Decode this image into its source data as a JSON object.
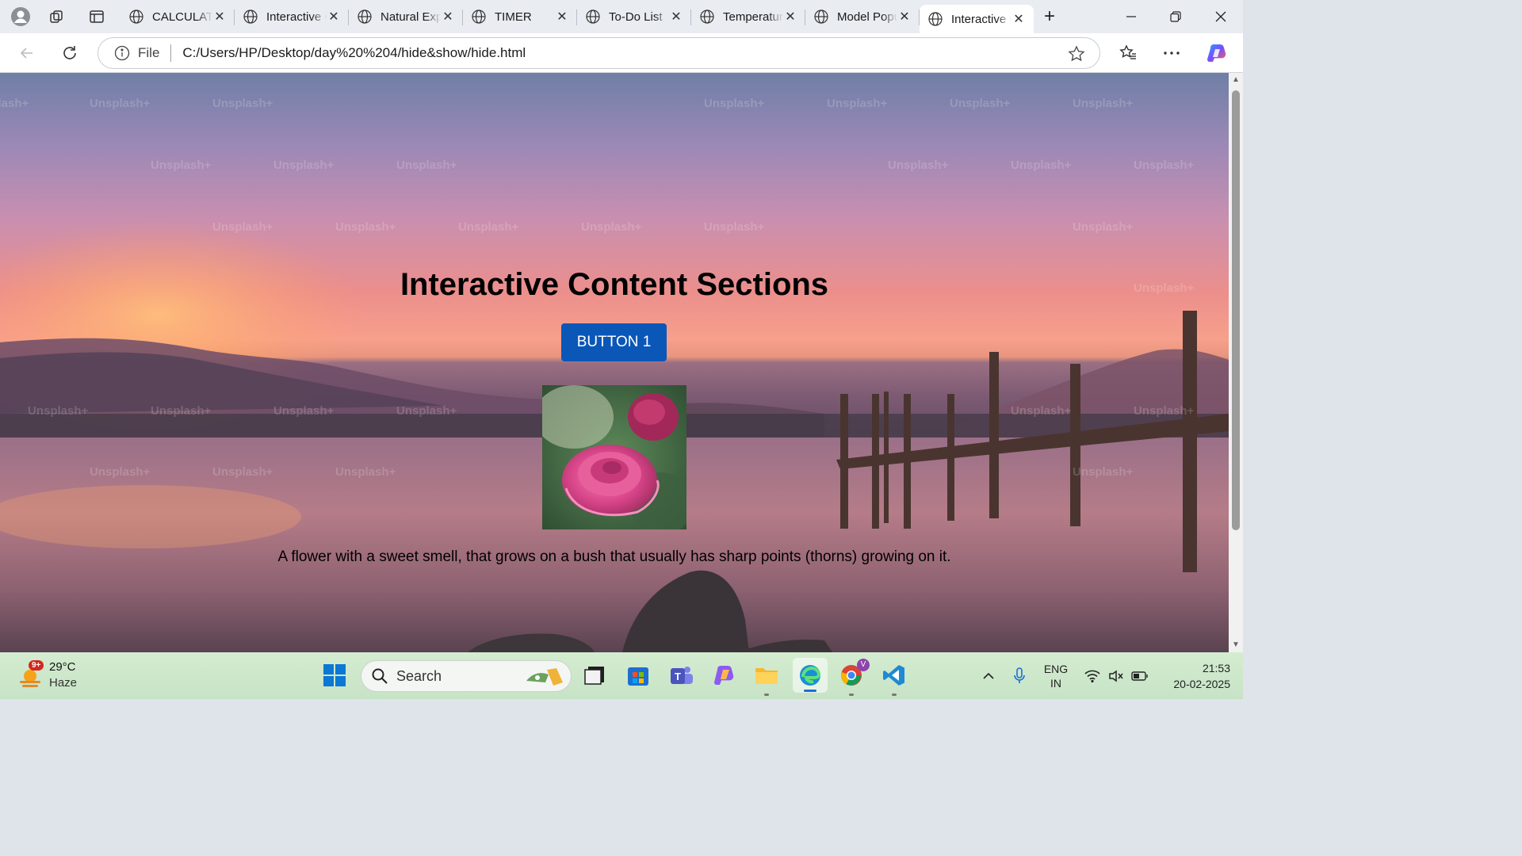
{
  "browser": {
    "tabs": [
      {
        "label": "CALCULATOR",
        "active": false
      },
      {
        "label": "Interactive Content Sections",
        "active": false
      },
      {
        "label": "Natural Explorer",
        "active": false
      },
      {
        "label": "TIMER",
        "active": false
      },
      {
        "label": "To-Do List",
        "active": false
      },
      {
        "label": "Temperature",
        "active": false
      },
      {
        "label": "Model Popup",
        "active": false
      },
      {
        "label": "Interactive Content Sections",
        "active": true
      }
    ],
    "address": {
      "scheme_label": "File",
      "url": "C:/Users/HP/Desktop/day%20%204/hide&show/hide.html"
    }
  },
  "page": {
    "heading": "Interactive Content Sections",
    "button_label": "BUTTON 1",
    "description": "A flower with a sweet smell, that grows on a bush that usually has sharp points (thorns) growing on it.",
    "watermark": "Unsplash+"
  },
  "taskbar": {
    "weather": {
      "temp": "29°C",
      "condition": "Haze",
      "badge": "9+"
    },
    "search_label": "Search",
    "tray": {
      "lang_top": "ENG",
      "lang_bottom": "IN",
      "time": "21:53",
      "date": "20-02-2025"
    }
  },
  "colors": {
    "button_bg": "#0a57b8",
    "taskbar_bg": "#cfe7cf",
    "tab_active_bg": "#ffffff"
  }
}
